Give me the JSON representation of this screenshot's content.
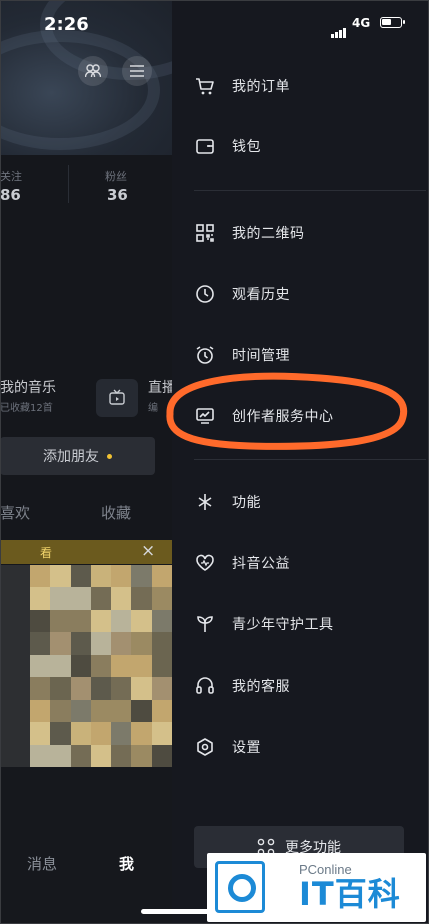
{
  "status_bar": {
    "time": "2:26",
    "network": "4G"
  },
  "profile": {
    "stats": [
      {
        "label": "关注",
        "value": "86"
      },
      {
        "label": "粉丝",
        "value": "36"
      }
    ],
    "music": {
      "title": "我的音乐",
      "subtitle": "已收藏12首"
    },
    "live": {
      "title": "直播",
      "subtitle": "编"
    },
    "add_friend": "添加朋友",
    "tabs": [
      "喜欢",
      "收藏"
    ],
    "promo_text": "看",
    "bottom_nav": {
      "messages": "消息",
      "me": "我"
    }
  },
  "drawer": {
    "items": [
      {
        "label": "我的订单",
        "icon": "cart-icon"
      },
      {
        "label": "钱包",
        "icon": "wallet-icon"
      },
      {
        "label": "我的二维码",
        "icon": "qr-code-icon"
      },
      {
        "label": "观看历史",
        "icon": "clock-icon"
      },
      {
        "label": "时间管理",
        "icon": "alarm-icon"
      },
      {
        "label": "创作者服务中心",
        "icon": "chart-monitor-icon"
      },
      {
        "label": "功能",
        "icon": "sparkle-icon"
      },
      {
        "label": "抖音公益",
        "icon": "heart-icon"
      },
      {
        "label": "青少年守护工具",
        "icon": "sprout-icon"
      },
      {
        "label": "我的客服",
        "icon": "headset-icon"
      },
      {
        "label": "设置",
        "icon": "settings-icon"
      }
    ],
    "more_button": "更多功能"
  },
  "watermark": {
    "top": "PConline",
    "brand": "IT百科"
  },
  "colors": {
    "highlight": "#ff6a2b",
    "drawer_bg": "#16181f",
    "accent_dot": "#f2c233",
    "watermark_blue": "#1c8ad6"
  }
}
